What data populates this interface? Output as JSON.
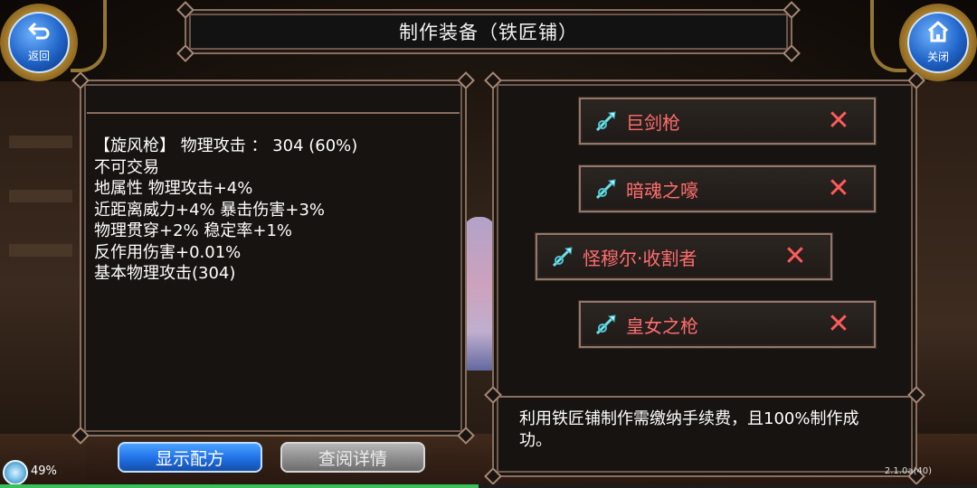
{
  "header": {
    "title": "制作装备（铁匠铺）",
    "back_label": "返回",
    "close_label": "关闭"
  },
  "detail": {
    "lines": [
      "【旋风枪】 物理攻击 ： 304 (60%)",
      "不可交易",
      "地属性 物理攻击+4%",
      "近距离威力+4% 暴击伤害+3%",
      "物理贯穿+2% 稳定率+1%",
      "反作用伤害+0.01%",
      "基本物理攻击(304)"
    ]
  },
  "recipes": [
    {
      "name": "巨剑枪"
    },
    {
      "name": "暗魂之嚎"
    },
    {
      "name": "怪穆尔·收割者"
    },
    {
      "name": "皇女之枪"
    }
  ],
  "note": "利用铁匠铺制作需缴纳手续费，且100%制作成功。",
  "buttons": {
    "show_recipe": "显示配方",
    "view_details": "查阅详情"
  },
  "status": {
    "percent": "49%",
    "progress_fraction": 0.49,
    "version": "2.1.0a(40)"
  },
  "colors": {
    "recipe_text": "#ff6e6e",
    "primary_button": "#1f6fe6",
    "disabled_button": "#8c8c8c",
    "panel_border": "#8a6e5e"
  },
  "icons": {
    "recipe_item": "spear-weapon-icon",
    "remove": "close-x-icon",
    "back": "return-arrow-icon",
    "close": "house-icon"
  }
}
